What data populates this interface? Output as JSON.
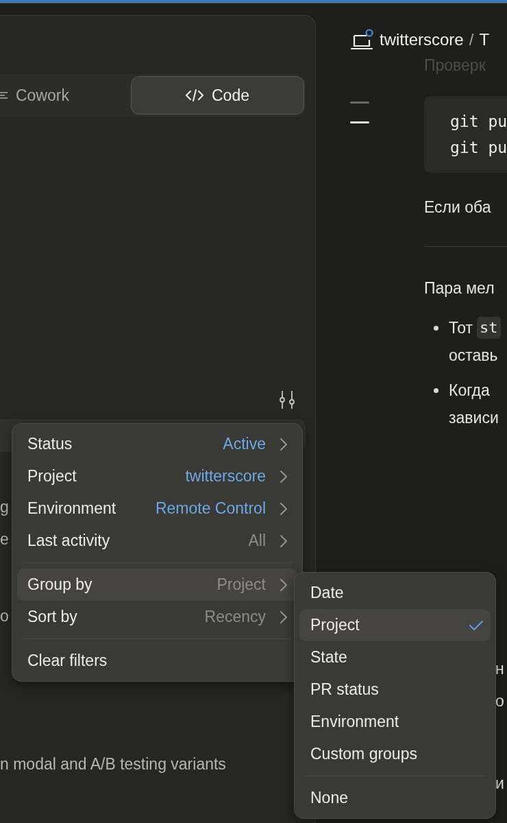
{
  "tabs": [
    {
      "label": "Cowork",
      "selected": false
    },
    {
      "label": "Code",
      "selected": true
    }
  ],
  "sidebar": {
    "row_fragments": [
      "g",
      "e",
      "o"
    ],
    "session_title": "n modal and A/B testing variants"
  },
  "filter_menu": {
    "sections": [
      {
        "items": [
          {
            "label": "Status",
            "value": "Active",
            "active": true,
            "selected": false,
            "kind": "submenu"
          },
          {
            "label": "Project",
            "value": "twitterscore",
            "active": true,
            "selected": false,
            "kind": "submenu"
          },
          {
            "label": "Environment",
            "value": "Remote Control",
            "active": true,
            "selected": false,
            "kind": "submenu"
          },
          {
            "label": "Last activity",
            "value": "All",
            "active": false,
            "selected": false,
            "kind": "submenu"
          }
        ]
      },
      {
        "items": [
          {
            "label": "Group by",
            "value": "Project",
            "active": false,
            "selected": true,
            "kind": "submenu"
          },
          {
            "label": "Sort by",
            "value": "Recency",
            "active": false,
            "selected": false,
            "kind": "submenu"
          }
        ]
      },
      {
        "items": [
          {
            "label": "Clear filters",
            "selected": false,
            "kind": "action"
          }
        ]
      }
    ]
  },
  "group_by_menu": {
    "sections": [
      {
        "items": [
          {
            "label": "Date",
            "selected": false
          },
          {
            "label": "Project",
            "selected": true
          },
          {
            "label": "State",
            "selected": false
          },
          {
            "label": "PR status",
            "selected": false
          },
          {
            "label": "Environment",
            "selected": false
          },
          {
            "label": "Custom groups",
            "selected": false
          }
        ]
      },
      {
        "items": [
          {
            "label": "None",
            "selected": false
          }
        ]
      }
    ]
  },
  "breadcrumb": {
    "project": "twitterscore",
    "separator": "/",
    "page": "T"
  },
  "outline_marks": [
    {
      "selected": false
    },
    {
      "selected": true
    }
  ],
  "document": {
    "faded_heading": "Проверк",
    "code_lines": [
      "git pu",
      "git pu"
    ],
    "paragraph_1": "Если оба",
    "paragraph_2": "Пара мел",
    "bullets": [
      {
        "lines": [
          {
            "text": "Тот",
            "code": "st"
          },
          {
            "text": "оставь"
          }
        ]
      },
      {
        "lines": [
          {
            "text": "Когда"
          },
          {
            "text": "зависи"
          }
        ]
      }
    ],
    "edge_fragments": [
      "н",
      "о",
      "и"
    ]
  }
}
